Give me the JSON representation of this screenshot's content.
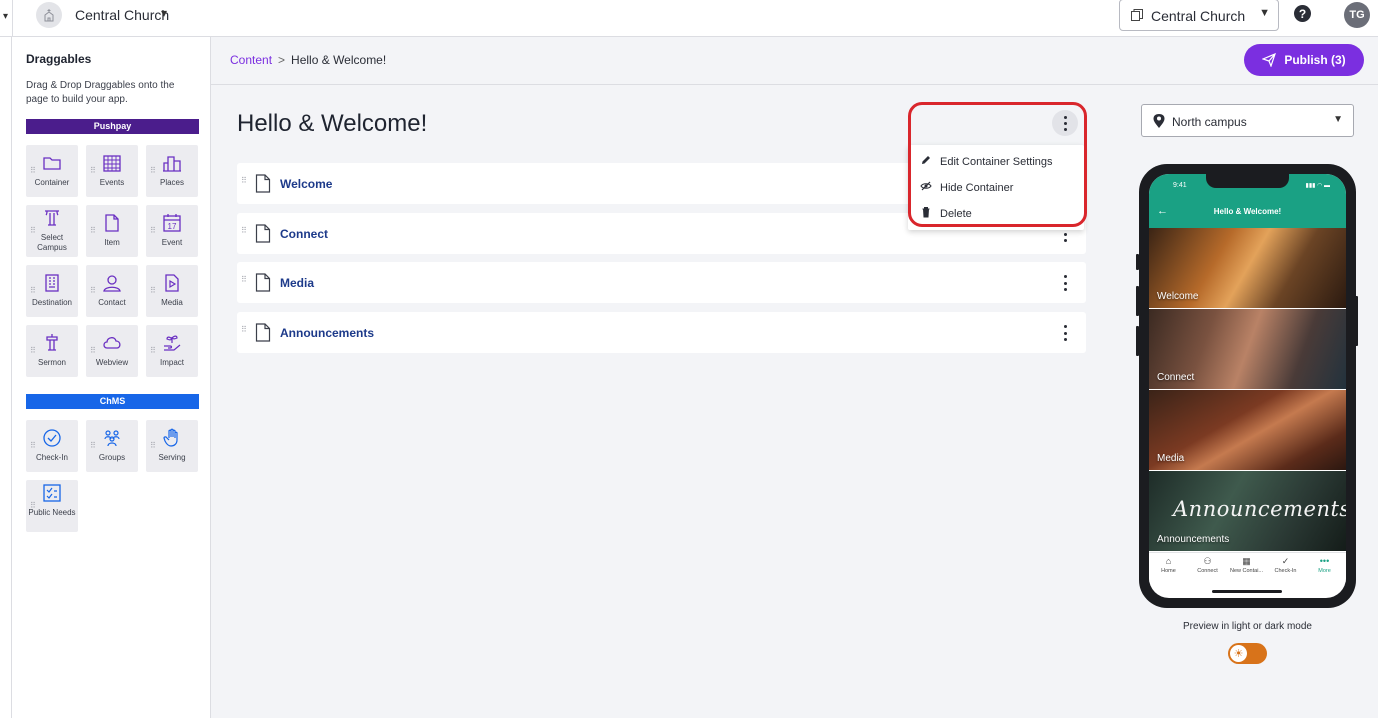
{
  "topbar": {
    "org_name": "Central Church",
    "campus_select": "Central Church",
    "help": "?",
    "user_initials": "TG"
  },
  "sidebar": {
    "title": "Draggables",
    "description": "Drag & Drop Draggables onto the page to build your app.",
    "pushpay_label": "Pushpay",
    "pushpay_items": [
      {
        "label": "Container",
        "icon": "folder-icon"
      },
      {
        "label": "Events",
        "icon": "calendar-grid-icon"
      },
      {
        "label": "Places",
        "icon": "places-icon"
      },
      {
        "label": "Select Campus",
        "icon": "campus-pillar-icon"
      },
      {
        "label": "Item",
        "icon": "document-icon"
      },
      {
        "label": "Event",
        "icon": "calendar-day-icon"
      },
      {
        "label": "Destination",
        "icon": "building-icon"
      },
      {
        "label": "Contact",
        "icon": "person-icon"
      },
      {
        "label": "Media",
        "icon": "media-play-icon"
      },
      {
        "label": "Sermon",
        "icon": "podium-icon"
      },
      {
        "label": "Webview",
        "icon": "cloud-icon"
      },
      {
        "label": "Impact",
        "icon": "hand-plant-icon"
      }
    ],
    "calendar_day": "17",
    "chms_label": "ChMS",
    "chms_items": [
      {
        "label": "Check-In",
        "icon": "check-circle-icon"
      },
      {
        "label": "Groups",
        "icon": "groups-icon"
      },
      {
        "label": "Serving",
        "icon": "raised-hand-icon"
      },
      {
        "label": "Public Needs",
        "icon": "checklist-icon"
      }
    ]
  },
  "breadcrumb": {
    "root": "Content",
    "separator": ">",
    "current": "Hello & Welcome!"
  },
  "publish_button": "Publish (3)",
  "page_title": "Hello & Welcome!",
  "containers": [
    {
      "name": "Welcome"
    },
    {
      "name": "Connect"
    },
    {
      "name": "Media"
    },
    {
      "name": "Announcements"
    }
  ],
  "context_menu": {
    "items": [
      {
        "label": "Edit Container Settings",
        "icon": "pencil-icon"
      },
      {
        "label": "Hide Container",
        "icon": "eye-slash-icon"
      },
      {
        "label": "Delete",
        "icon": "trash-icon"
      }
    ]
  },
  "preview": {
    "campus": "North campus",
    "phone": {
      "time": "9:41",
      "header_title": "Hello & Welcome!",
      "cards": [
        "Welcome",
        "Connect",
        "Media",
        "Announcements"
      ],
      "announcements_script": "Announcements",
      "tabs": [
        {
          "label": "Home",
          "icon": "home-icon"
        },
        {
          "label": "Connect",
          "icon": "people-icon"
        },
        {
          "label": "New Contai...",
          "icon": "grid-icon"
        },
        {
          "label": "Check-In",
          "icon": "check-icon"
        },
        {
          "label": "More",
          "icon": "more-dots-icon"
        }
      ],
      "accent_color": "#1aa184"
    },
    "mode_label": "Preview in light or dark mode",
    "mode_toggle": "dark"
  },
  "colors": {
    "brand_purple": "#7b2fe0",
    "pushpay_bar": "#4b1d8c",
    "chms_bar": "#1766e8",
    "highlight_red": "#d9262c",
    "toggle_orange": "#d8731a"
  }
}
